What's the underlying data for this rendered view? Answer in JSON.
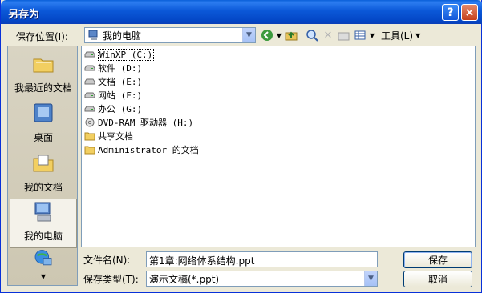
{
  "window": {
    "title": "另存为"
  },
  "titlebar": {
    "help_label": "?",
    "close_label": "×"
  },
  "location": {
    "label": "保存位置(I):",
    "value": "我的电脑"
  },
  "toolbar": {
    "tools_label": "工具(L)"
  },
  "places": [
    {
      "label": "我最近的文档",
      "icon": "recent-docs-icon"
    },
    {
      "label": "桌面",
      "icon": "desktop-icon"
    },
    {
      "label": "我的文档",
      "icon": "my-docs-icon"
    },
    {
      "label": "我的电脑",
      "icon": "my-computer-icon",
      "selected": true
    },
    {
      "label": "",
      "icon": "network-places-icon"
    }
  ],
  "files": [
    {
      "name": "WinXP (C:)",
      "icon": "drive-icon"
    },
    {
      "name": "软件 (D:)",
      "icon": "drive-icon"
    },
    {
      "name": "文档 (E:)",
      "icon": "drive-icon"
    },
    {
      "name": "网站 (F:)",
      "icon": "drive-icon"
    },
    {
      "name": "办公 (G:)",
      "icon": "drive-icon"
    },
    {
      "name": "DVD-RAM 驱动器 (H:)",
      "icon": "dvd-drive-icon"
    },
    {
      "name": "共享文档",
      "icon": "folder-icon"
    },
    {
      "name": "Administrator 的文档",
      "icon": "folder-icon"
    }
  ],
  "form": {
    "filename_label": "文件名(N):",
    "filename_value": "第1章:网络体系结构.ppt",
    "filetype_label": "保存类型(T):",
    "filetype_value": "演示文稿(*.ppt)",
    "save_label": "保存",
    "cancel_label": "取消"
  },
  "colors": {
    "titlebar": "#0b58d8",
    "face": "#ece9d8",
    "border": "#7f9db9"
  }
}
